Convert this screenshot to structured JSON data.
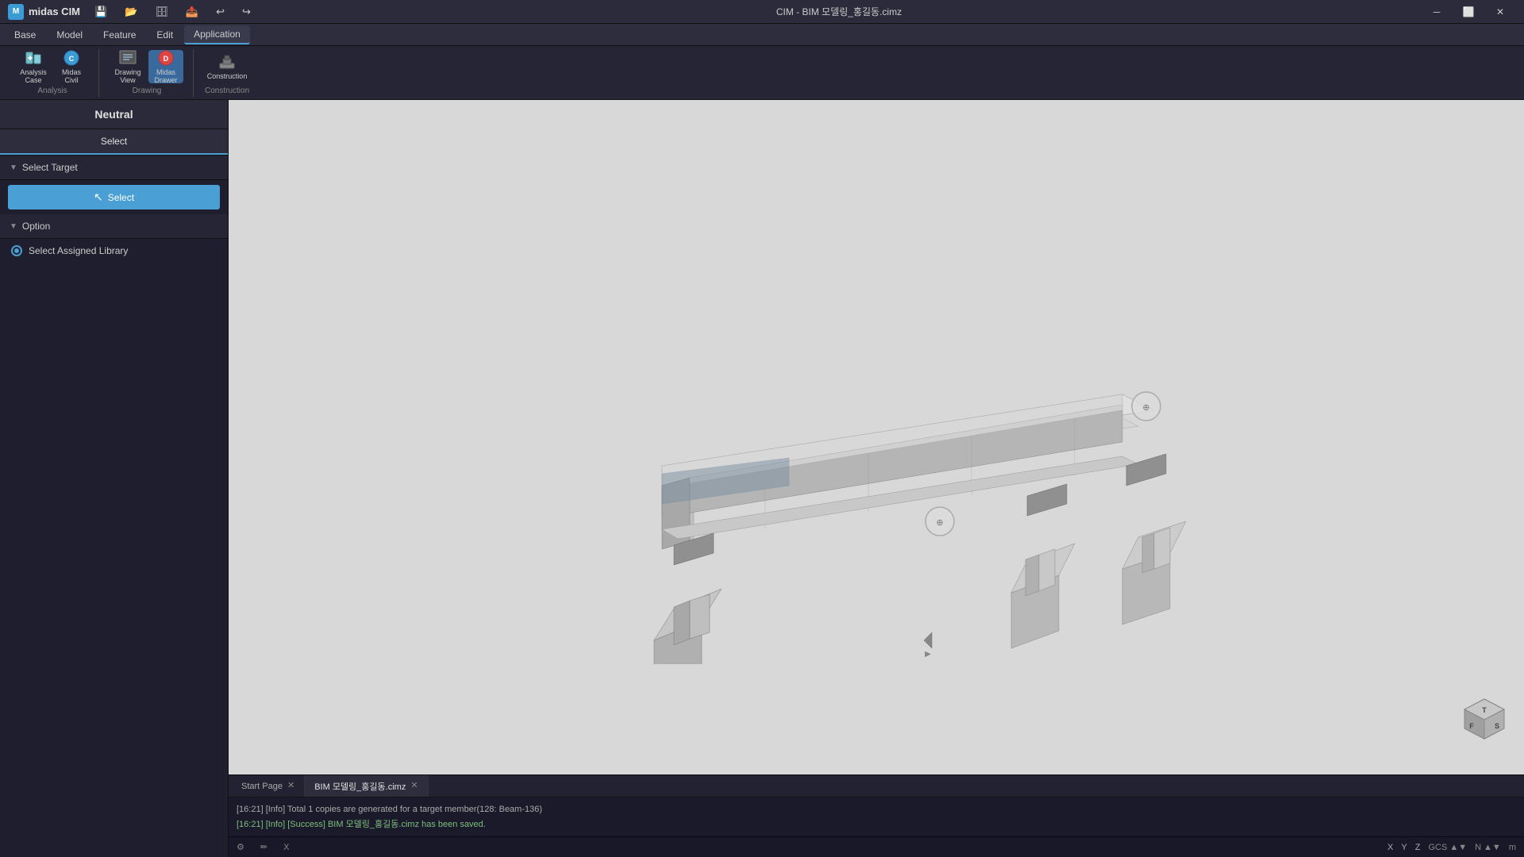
{
  "app": {
    "name": "midas CIM",
    "title": "CIM - BIM 모델링_홍길동.cimz"
  },
  "titlebar": {
    "logo_text": "midas CIM",
    "window_buttons": [
      "minimize",
      "restore",
      "close"
    ],
    "toolbar_buttons": [
      "save",
      "open",
      "saveas",
      "export",
      "undo",
      "redo"
    ]
  },
  "menubar": {
    "items": [
      "Base",
      "Model",
      "Feature",
      "Edit",
      "Application"
    ]
  },
  "toolbar": {
    "groups": [
      {
        "label": "Analysis",
        "buttons": [
          {
            "id": "analysis-case",
            "label": "Analysis Case"
          },
          {
            "id": "midas-civil",
            "label": "Midas Civil"
          }
        ]
      },
      {
        "label": "Drawing",
        "buttons": [
          {
            "id": "drawing-view",
            "label": "Drawing View"
          },
          {
            "id": "midas-drawer",
            "label": "Midas Drawer"
          }
        ]
      },
      {
        "label": "Construction",
        "buttons": [
          {
            "id": "construction",
            "label": "Construction"
          }
        ]
      }
    ]
  },
  "panel": {
    "title": "Neutral",
    "tabs": [
      {
        "id": "select",
        "label": "Select",
        "active": true
      }
    ],
    "select_target": {
      "label": "Select Target",
      "button_label": "Select",
      "button_icon": "cursor"
    },
    "option": {
      "label": "Option",
      "items": [
        {
          "id": "select-assigned-library",
          "label": "Select Assigned Library",
          "checked": true
        }
      ]
    }
  },
  "viewport": {
    "background": "#c8c8c8",
    "view_nav_label": "⊕",
    "model_file": "BIM 모델링_홍길동.cimz"
  },
  "viewport_tabs": [
    {
      "id": "start-page",
      "label": "Start Page",
      "active": false
    },
    {
      "id": "bim-model",
      "label": "BIM 모델링_홍길동.cimz",
      "active": true
    }
  ],
  "statusbar": {
    "messages": [
      "[16:21] [Info] Total 1 copies are generated for a target member(128: Beam-136)",
      "[16:21] [Info] [Success] BIM 모델링_홍길동.cimz has been saved."
    ],
    "coords": {
      "x_label": "X",
      "y_label": "Y",
      "z_label": "Z",
      "gcs_label": "GCS",
      "n_label": "N",
      "unit_label": "m",
      "x_val": "",
      "y_val": "",
      "z_val": ""
    }
  }
}
